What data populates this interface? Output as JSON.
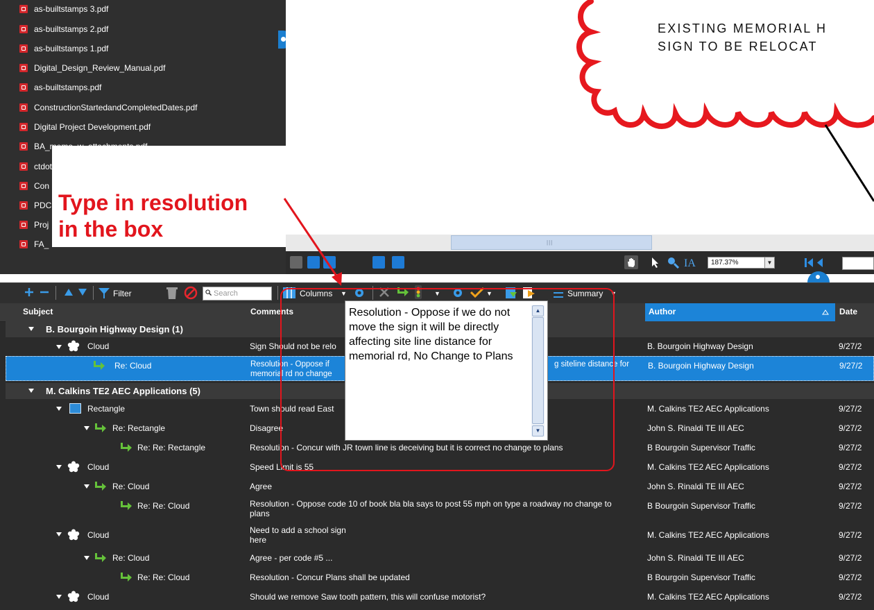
{
  "files": [
    "as-builtstamps 3.pdf",
    "as-builtstamps 2.pdf",
    "as-builtstamps 1.pdf",
    "Digital_Design_Review_Manual.pdf",
    "as-builtstamps.pdf",
    "ConstructionStartedandCompletedDates.pdf",
    "Digital Project Development.pdf",
    "BA_memo_w_attachments.pdf",
    "ctdot",
    "Con",
    "PDC",
    "Proj",
    "FA_"
  ],
  "drawing": {
    "line1": "EXISTING MEMORIAL H",
    "line2": "SIGN TO BE RELOCAT",
    "scroll_grip": "|||"
  },
  "viewer": {
    "zoom": "187.37%"
  },
  "toolbar": {
    "filter_label": "Filter",
    "search_placeholder": "Search",
    "columns_label": "Columns",
    "summary_label": "Summary"
  },
  "columns": {
    "subject": "Subject",
    "comments": "Comments",
    "author": "Author",
    "date": "Date"
  },
  "groups": [
    {
      "label": "B. Bourgoin Highway Design (1)"
    },
    {
      "label": "M. Calkins TE2 AEC Applications (5)"
    }
  ],
  "rows": [
    {
      "subject": "Cloud",
      "comments": "Sign Should not be relo",
      "author": "B. Bourgoin Highway Design",
      "date": "9/27/2"
    },
    {
      "subject": "Re: Cloud",
      "comments": "Resolution - Oppose if",
      "comments_right": "g siteline distance for",
      "comments_line2": "memorial rd no change",
      "author": "B. Bourgoin Highway Design",
      "date": "9/27/2"
    },
    {
      "subject": "Rectangle",
      "comments": "Town should read East",
      "author": "M. Calkins TE2 AEC Applications",
      "date": "9/27/2"
    },
    {
      "subject": "Re: Rectangle",
      "comments": "Disagree",
      "author": "John S. Rinaldi TE III AEC",
      "date": "9/27/2"
    },
    {
      "subject": "Re: Re: Rectangle",
      "comments": "Resolution - Concur with JR town line is deceiving but it is correct no change to plans",
      "author": "B Bourgoin Supervisor Traffic",
      "date": "9/27/2"
    },
    {
      "subject": "Cloud",
      "comments": "Speed Limit is 55",
      "author": "M. Calkins TE2 AEC Applications",
      "date": "9/27/2"
    },
    {
      "subject": "Re: Cloud",
      "comments": "Agree",
      "author": "John S. Rinaldi TE III AEC",
      "date": "9/27/2"
    },
    {
      "subject": "Re: Re: Cloud",
      "comments": "Resolution - Oppose code 10 of book bla bla says to post 55 mph on type a roadway no change to plans",
      "author": "B Bourgoin Supervisor Traffic",
      "date": "9/27/2"
    },
    {
      "subject": "Cloud",
      "comments": "Need to add a school sign here",
      "author": "M. Calkins TE2 AEC Applications",
      "date": "9/27/2"
    },
    {
      "subject": "Re: Cloud",
      "comments": "Agree - per code #5 ...",
      "author": "John S. Rinaldi TE III AEC",
      "date": "9/27/2"
    },
    {
      "subject": "Re: Re: Cloud",
      "comments": "Resolution - Concur Plans shall be updated",
      "author": "B Bourgoin Supervisor Traffic",
      "date": "9/27/2"
    },
    {
      "subject": "Cloud",
      "comments": "Should we remove Saw tooth pattern, this will confuse motorist?",
      "author": "M. Calkins TE2 AEC Applications",
      "date": "9/27/2"
    }
  ],
  "popup": {
    "text": "Resolution - Oppose if we do not move the sign it will be directly affecting site line distance for memorial rd, No Change to Plans"
  },
  "callout": {
    "line1": "Type in resolution",
    "line2": "in the box"
  },
  "colors": {
    "accent": "#1c84d8",
    "annotation": "#e2151d",
    "pdf_icon": "#d3262b"
  }
}
